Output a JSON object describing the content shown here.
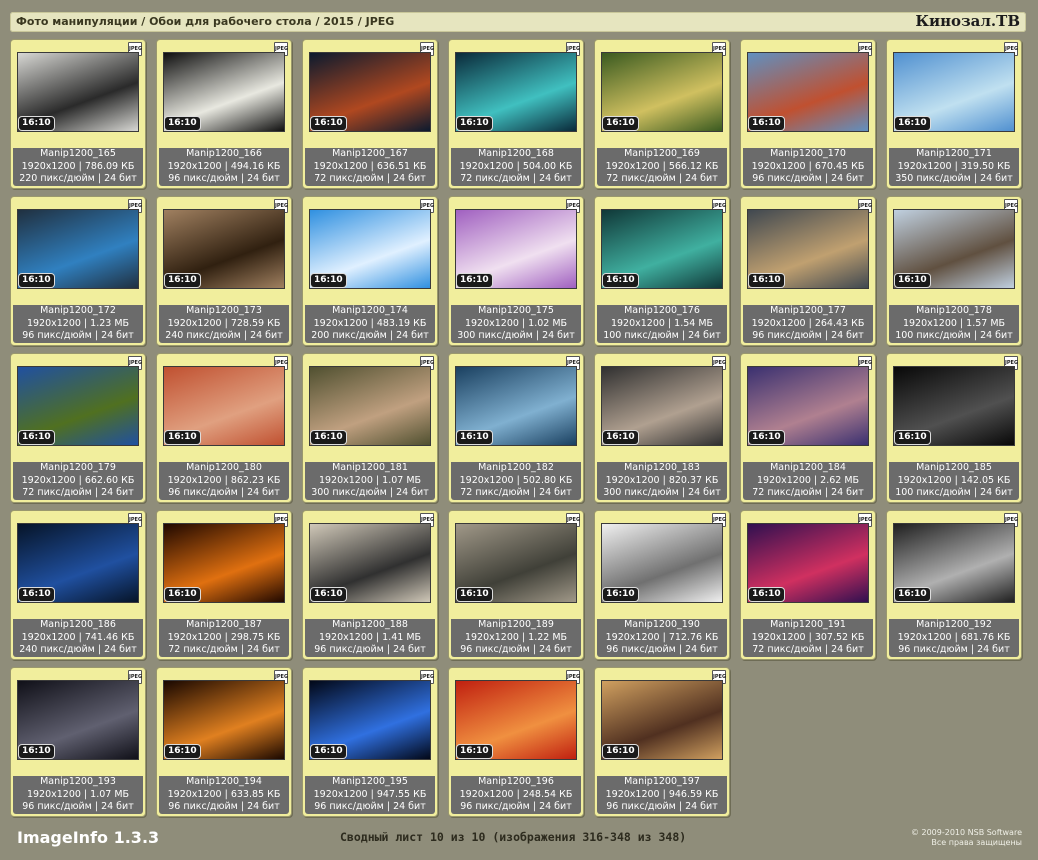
{
  "header": {
    "breadcrumb": "Фото манипуляции / Обои для рабочего стола / 2015 / JPEG",
    "site_title": "Кинозал.ТВ"
  },
  "format_badge": "JPEG",
  "aspect_label": "16:10",
  "images": [
    {
      "name": "Manip1200_165",
      "dims": "1920x1200",
      "size": "786.09 КБ",
      "dpi": "220 пикс/дюйм",
      "depth": "24 бит",
      "colors": [
        "#d8d8d4",
        "#2a2a2a"
      ]
    },
    {
      "name": "Manip1200_166",
      "dims": "1920x1200",
      "size": "494.16 КБ",
      "dpi": "96 пикс/дюйм",
      "depth": "24 бит",
      "colors": [
        "#101010",
        "#e8e8e0"
      ]
    },
    {
      "name": "Manip1200_167",
      "dims": "1920x1200",
      "size": "636.51 КБ",
      "dpi": "72 пикс/дюйм",
      "depth": "24 бит",
      "colors": [
        "#0c1a2e",
        "#b04820"
      ]
    },
    {
      "name": "Manip1200_168",
      "dims": "1920x1200",
      "size": "504.00 КБ",
      "dpi": "72 пикс/дюйм",
      "depth": "24 бит",
      "colors": [
        "#0a2a3a",
        "#40c0c0"
      ]
    },
    {
      "name": "Manip1200_169",
      "dims": "1920x1200",
      "size": "566.12 КБ",
      "dpi": "72 пикс/дюйм",
      "depth": "24 бит",
      "colors": [
        "#3a5a20",
        "#d0c060"
      ]
    },
    {
      "name": "Manip1200_170",
      "dims": "1920x1200",
      "size": "670.45 КБ",
      "dpi": "96 пикс/дюйм",
      "depth": "24 бит",
      "colors": [
        "#6090c0",
        "#c05030"
      ]
    },
    {
      "name": "Manip1200_171",
      "dims": "1920x1200",
      "size": "319.50 КБ",
      "dpi": "350 пикс/дюйм",
      "depth": "24 бит",
      "colors": [
        "#5090d0",
        "#c0e0f0"
      ]
    },
    {
      "name": "Manip1200_172",
      "dims": "1920x1200",
      "size": "1.23 МБ",
      "dpi": "96 пикс/дюйм",
      "depth": "24 бит",
      "colors": [
        "#203040",
        "#3080c0"
      ]
    },
    {
      "name": "Manip1200_173",
      "dims": "1920x1200",
      "size": "728.59 КБ",
      "dpi": "240 пикс/дюйм",
      "depth": "24 бит",
      "colors": [
        "#a08060",
        "#302010"
      ]
    },
    {
      "name": "Manip1200_174",
      "dims": "1920x1200",
      "size": "483.19 КБ",
      "dpi": "200 пикс/дюйм",
      "depth": "24 бит",
      "colors": [
        "#3090e0",
        "#e0f0ff"
      ]
    },
    {
      "name": "Manip1200_175",
      "dims": "1920x1200",
      "size": "1.02 МБ",
      "dpi": "300 пикс/дюйм",
      "depth": "24 бит",
      "colors": [
        "#a060c0",
        "#f0e0f0"
      ]
    },
    {
      "name": "Manip1200_176",
      "dims": "1920x1200",
      "size": "1.54 МБ",
      "dpi": "100 пикс/дюйм",
      "depth": "24 бит",
      "colors": [
        "#103838",
        "#40b0a0"
      ]
    },
    {
      "name": "Manip1200_177",
      "dims": "1920x1200",
      "size": "264.43 КБ",
      "dpi": "96 пикс/дюйм",
      "depth": "24 бит",
      "colors": [
        "#404850",
        "#c0a070"
      ]
    },
    {
      "name": "Manip1200_178",
      "dims": "1920x1200",
      "size": "1.57 МБ",
      "dpi": "100 пикс/дюйм",
      "depth": "24 бит",
      "colors": [
        "#c0d0e0",
        "#605040"
      ]
    },
    {
      "name": "Manip1200_179",
      "dims": "1920x1200",
      "size": "662.60 КБ",
      "dpi": "72 пикс/дюйм",
      "depth": "24 бит",
      "colors": [
        "#2050a0",
        "#507020"
      ]
    },
    {
      "name": "Manip1200_180",
      "dims": "1920x1200",
      "size": "862.23 КБ",
      "dpi": "96 пикс/дюйм",
      "depth": "24 бит",
      "colors": [
        "#c05030",
        "#e0a080"
      ]
    },
    {
      "name": "Manip1200_181",
      "dims": "1920x1200",
      "size": "1.07 МБ",
      "dpi": "300 пикс/дюйм",
      "depth": "24 бит",
      "colors": [
        "#505030",
        "#c0a080"
      ]
    },
    {
      "name": "Manip1200_182",
      "dims": "1920x1200",
      "size": "502.80 КБ",
      "dpi": "72 пикс/дюйм",
      "depth": "24 бит",
      "colors": [
        "#1a4060",
        "#80b0d0"
      ]
    },
    {
      "name": "Manip1200_183",
      "dims": "1920x1200",
      "size": "820.37 КБ",
      "dpi": "300 пикс/дюйм",
      "depth": "24 бит",
      "colors": [
        "#303030",
        "#b0a090"
      ]
    },
    {
      "name": "Manip1200_184",
      "dims": "1920x1200",
      "size": "2.62 МБ",
      "dpi": "72 пикс/дюйм",
      "depth": "24 бит",
      "colors": [
        "#3a3070",
        "#b08090"
      ]
    },
    {
      "name": "Manip1200_185",
      "dims": "1920x1200",
      "size": "142.05 КБ",
      "dpi": "100 пикс/дюйм",
      "depth": "24 бит",
      "colors": [
        "#080808",
        "#505050"
      ]
    },
    {
      "name": "Manip1200_186",
      "dims": "1920x1200",
      "size": "741.46 КБ",
      "dpi": "240 пикс/дюйм",
      "depth": "24 бит",
      "colors": [
        "#061428",
        "#2050a0"
      ]
    },
    {
      "name": "Manip1200_187",
      "dims": "1920x1200",
      "size": "298.75 КБ",
      "dpi": "72 пикс/дюйм",
      "depth": "24 бит",
      "colors": [
        "#200800",
        "#e07010"
      ]
    },
    {
      "name": "Manip1200_188",
      "dims": "1920x1200",
      "size": "1.41 МБ",
      "dpi": "96 пикс/дюйм",
      "depth": "24 бит",
      "colors": [
        "#d0c8b8",
        "#303030"
      ]
    },
    {
      "name": "Manip1200_189",
      "dims": "1920x1200",
      "size": "1.22 МБ",
      "dpi": "96 пикс/дюйм",
      "depth": "24 бит",
      "colors": [
        "#a09888",
        "#404038"
      ]
    },
    {
      "name": "Manip1200_190",
      "dims": "1920x1200",
      "size": "712.76 КБ",
      "dpi": "96 пикс/дюйм",
      "depth": "24 бит",
      "colors": [
        "#f0f0f0",
        "#707070"
      ]
    },
    {
      "name": "Manip1200_191",
      "dims": "1920x1200",
      "size": "307.52 КБ",
      "dpi": "72 пикс/дюйм",
      "depth": "24 бит",
      "colors": [
        "#301050",
        "#d03060"
      ]
    },
    {
      "name": "Manip1200_192",
      "dims": "1920x1200",
      "size": "681.76 КБ",
      "dpi": "96 пикс/дюйм",
      "depth": "24 бит",
      "colors": [
        "#202020",
        "#b0b0b0"
      ]
    },
    {
      "name": "Manip1200_193",
      "dims": "1920x1200",
      "size": "1.07 МБ",
      "dpi": "96 пикс/дюйм",
      "depth": "24 бит",
      "colors": [
        "#101018",
        "#606070"
      ]
    },
    {
      "name": "Manip1200_194",
      "dims": "1920x1200",
      "size": "633.85 КБ",
      "dpi": "96 пикс/дюйм",
      "depth": "24 бит",
      "colors": [
        "#1a0800",
        "#e08020"
      ]
    },
    {
      "name": "Manip1200_195",
      "dims": "1920x1200",
      "size": "947.55 КБ",
      "dpi": "96 пикс/дюйм",
      "depth": "24 бит",
      "colors": [
        "#020818",
        "#3070e0"
      ]
    },
    {
      "name": "Manip1200_196",
      "dims": "1920x1200",
      "size": "248.54 КБ",
      "dpi": "96 пикс/дюйм",
      "depth": "24 бит",
      "colors": [
        "#c02010",
        "#f09040"
      ]
    },
    {
      "name": "Manip1200_197",
      "dims": "1920x1200",
      "size": "946.59 КБ",
      "dpi": "96 пикс/дюйм",
      "depth": "24 бит",
      "colors": [
        "#d0a060",
        "#503020"
      ]
    }
  ],
  "footer": {
    "brand": "ImageInfo 1.3.3",
    "summary": "Сводный лист 10 из 10 (изображения 316-348 из 348)",
    "copyright_line1": "© 2009-2010 NSB Software",
    "copyright_line2": "Все права защищены"
  },
  "colors": {
    "background": "#8f8d7a",
    "tile": "#f1ee9d",
    "caption": "#6b6b6b",
    "header": "#e6e5bf"
  }
}
